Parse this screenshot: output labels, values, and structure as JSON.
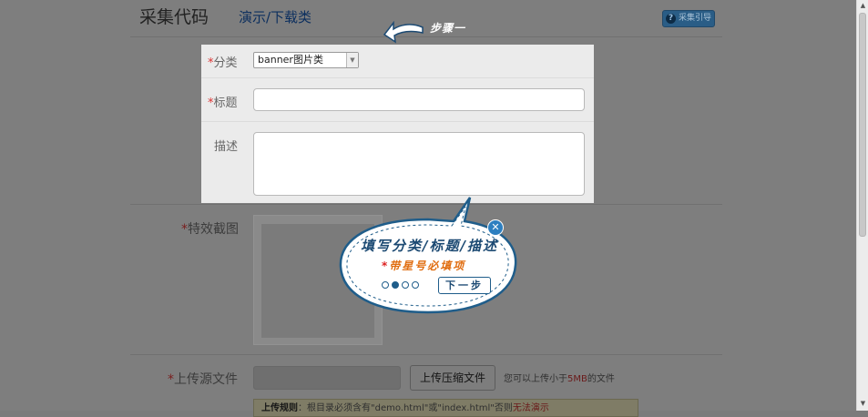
{
  "header": {
    "title": "采集代码",
    "subtitle": "演示/下载类",
    "guide_button": "采集引导"
  },
  "tour": {
    "step_label": "步骤一",
    "bubble_title": "填写分类/标题/描述",
    "bubble_star": "*",
    "bubble_note": "带星号必填项",
    "next_button": "下一步",
    "dots_total": 4,
    "dots_active": 2
  },
  "form": {
    "category_label": "分类",
    "category_value": "banner图片类",
    "title_label": "标题",
    "title_value": "",
    "desc_label": "描述",
    "desc_value": ""
  },
  "background_form": {
    "screenshot_label": "特效截图",
    "upload_label": "上传源文件",
    "upload_button": "上传压缩文件",
    "upload_note_pre": "您可以上传小于",
    "upload_note_limit": "5MB",
    "upload_note_post": "的文件",
    "tip_bold": "上传规则",
    "tip_text": "：根目录必须含有\"demo.html\"或\"index.html\"否则",
    "tip_warn": "无法演示"
  },
  "colors": {
    "required_star": "#dd3333",
    "bubble_blue": "#1c4a73",
    "bubble_orange": "#e06d10"
  }
}
